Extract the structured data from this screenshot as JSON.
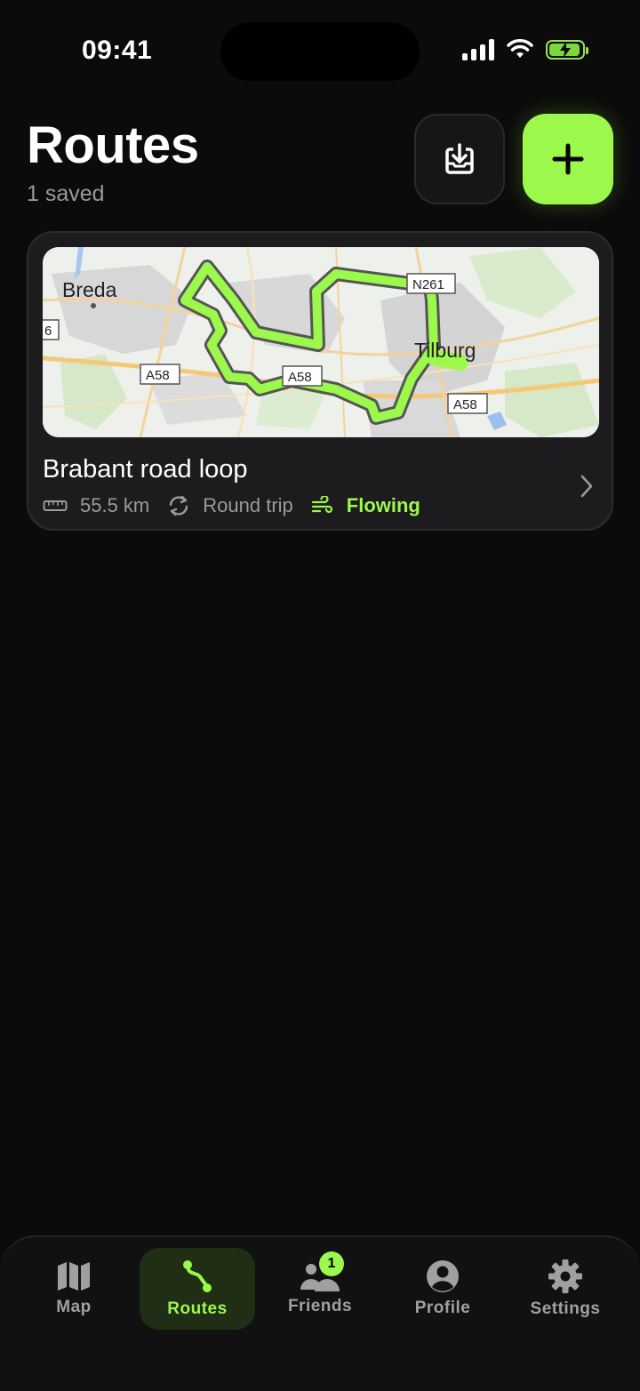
{
  "status": {
    "time": "09:41"
  },
  "header": {
    "title": "Routes",
    "subtitle": "1 saved"
  },
  "actions": {
    "import_icon": "download-tray-icon",
    "add_icon": "plus-icon"
  },
  "route": {
    "name": "Brabant road loop",
    "distance": "55.5 km",
    "type": "Round trip",
    "character": "Flowing",
    "map": {
      "labels": {
        "city1": "Breda",
        "city2": "Tilburg",
        "road1": "A58",
        "road2": "A58",
        "road3": "A58",
        "road4": "N261",
        "road5": "6"
      }
    }
  },
  "tabs": [
    {
      "label": "Map",
      "icon": "map-icon"
    },
    {
      "label": "Routes",
      "icon": "route-icon"
    },
    {
      "label": "Friends",
      "icon": "friends-icon",
      "badge": "1"
    },
    {
      "label": "Profile",
      "icon": "profile-icon"
    },
    {
      "label": "Settings",
      "icon": "gear-icon"
    }
  ],
  "colors": {
    "accent": "#9cf84b",
    "background": "#0b0b0b",
    "card": "#1c1c1e"
  }
}
